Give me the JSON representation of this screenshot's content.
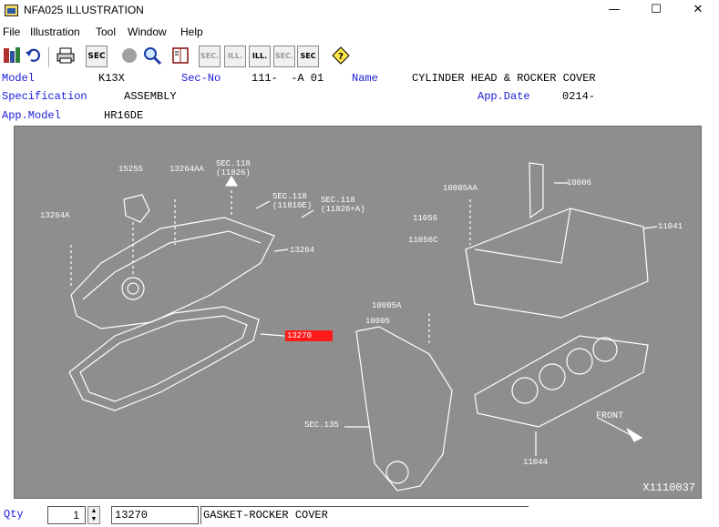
{
  "window": {
    "title": "NFA025  ILLUSTRATION",
    "minimize_glyph": "—",
    "maximize_glyph": "☐",
    "close_glyph": "✕"
  },
  "menu": {
    "file": "File",
    "illustration": "Illustration",
    "tool": "Tool",
    "window": "Window",
    "help": "Help"
  },
  "toolbar": {
    "sec": "SEC",
    "sec_prev": "SEC.",
    "ill_prev": "ILL.",
    "ill_next": "ILL.",
    "sec_next": "SEC.",
    "sec_query": "SEC"
  },
  "info": {
    "model_label": "Model",
    "model_value": "K13X",
    "secno_label": "Sec-No",
    "secno_value": "111-  -A 01",
    "name_label": "Name",
    "name_value": "CYLINDER HEAD & ROCKER COVER",
    "spec_label": "Specification",
    "spec_value": "ASSEMBLY",
    "appdate_label": "App.Date",
    "appdate_value": "0214-",
    "appmodel_label": "App.Model",
    "appmodel_value": "HR16DE"
  },
  "illustration": {
    "drawing_id": "X1110037",
    "callouts": {
      "c15255": "15255",
      "c13264aa": "13264AA",
      "sec118a": "SEC.118\n(11826)",
      "sec118b": "SEC.118\n(11810E)",
      "sec118c": "SEC.118\n(11826+A)",
      "c13264a": "13264A",
      "c13264": "13264",
      "c13270": "13270",
      "c10005aa": "10005AA",
      "c10006": "10006",
      "c11056": "11056",
      "c11041": "11041",
      "c11056c": "11056C",
      "c10005a": "10005A",
      "c10005": "10005",
      "sec135": "SEC.135",
      "front": "FRONT",
      "c11044": "11044"
    }
  },
  "bottom": {
    "qty_label": "Qty",
    "qty_value": "1",
    "part_number": "13270",
    "part_name": "GASKET-ROCKER COVER"
  },
  "colors": {
    "label_blue": "#1a1ad8",
    "illustration_bg": "#8e8e8e",
    "highlight_red": "#ff1a1a"
  }
}
